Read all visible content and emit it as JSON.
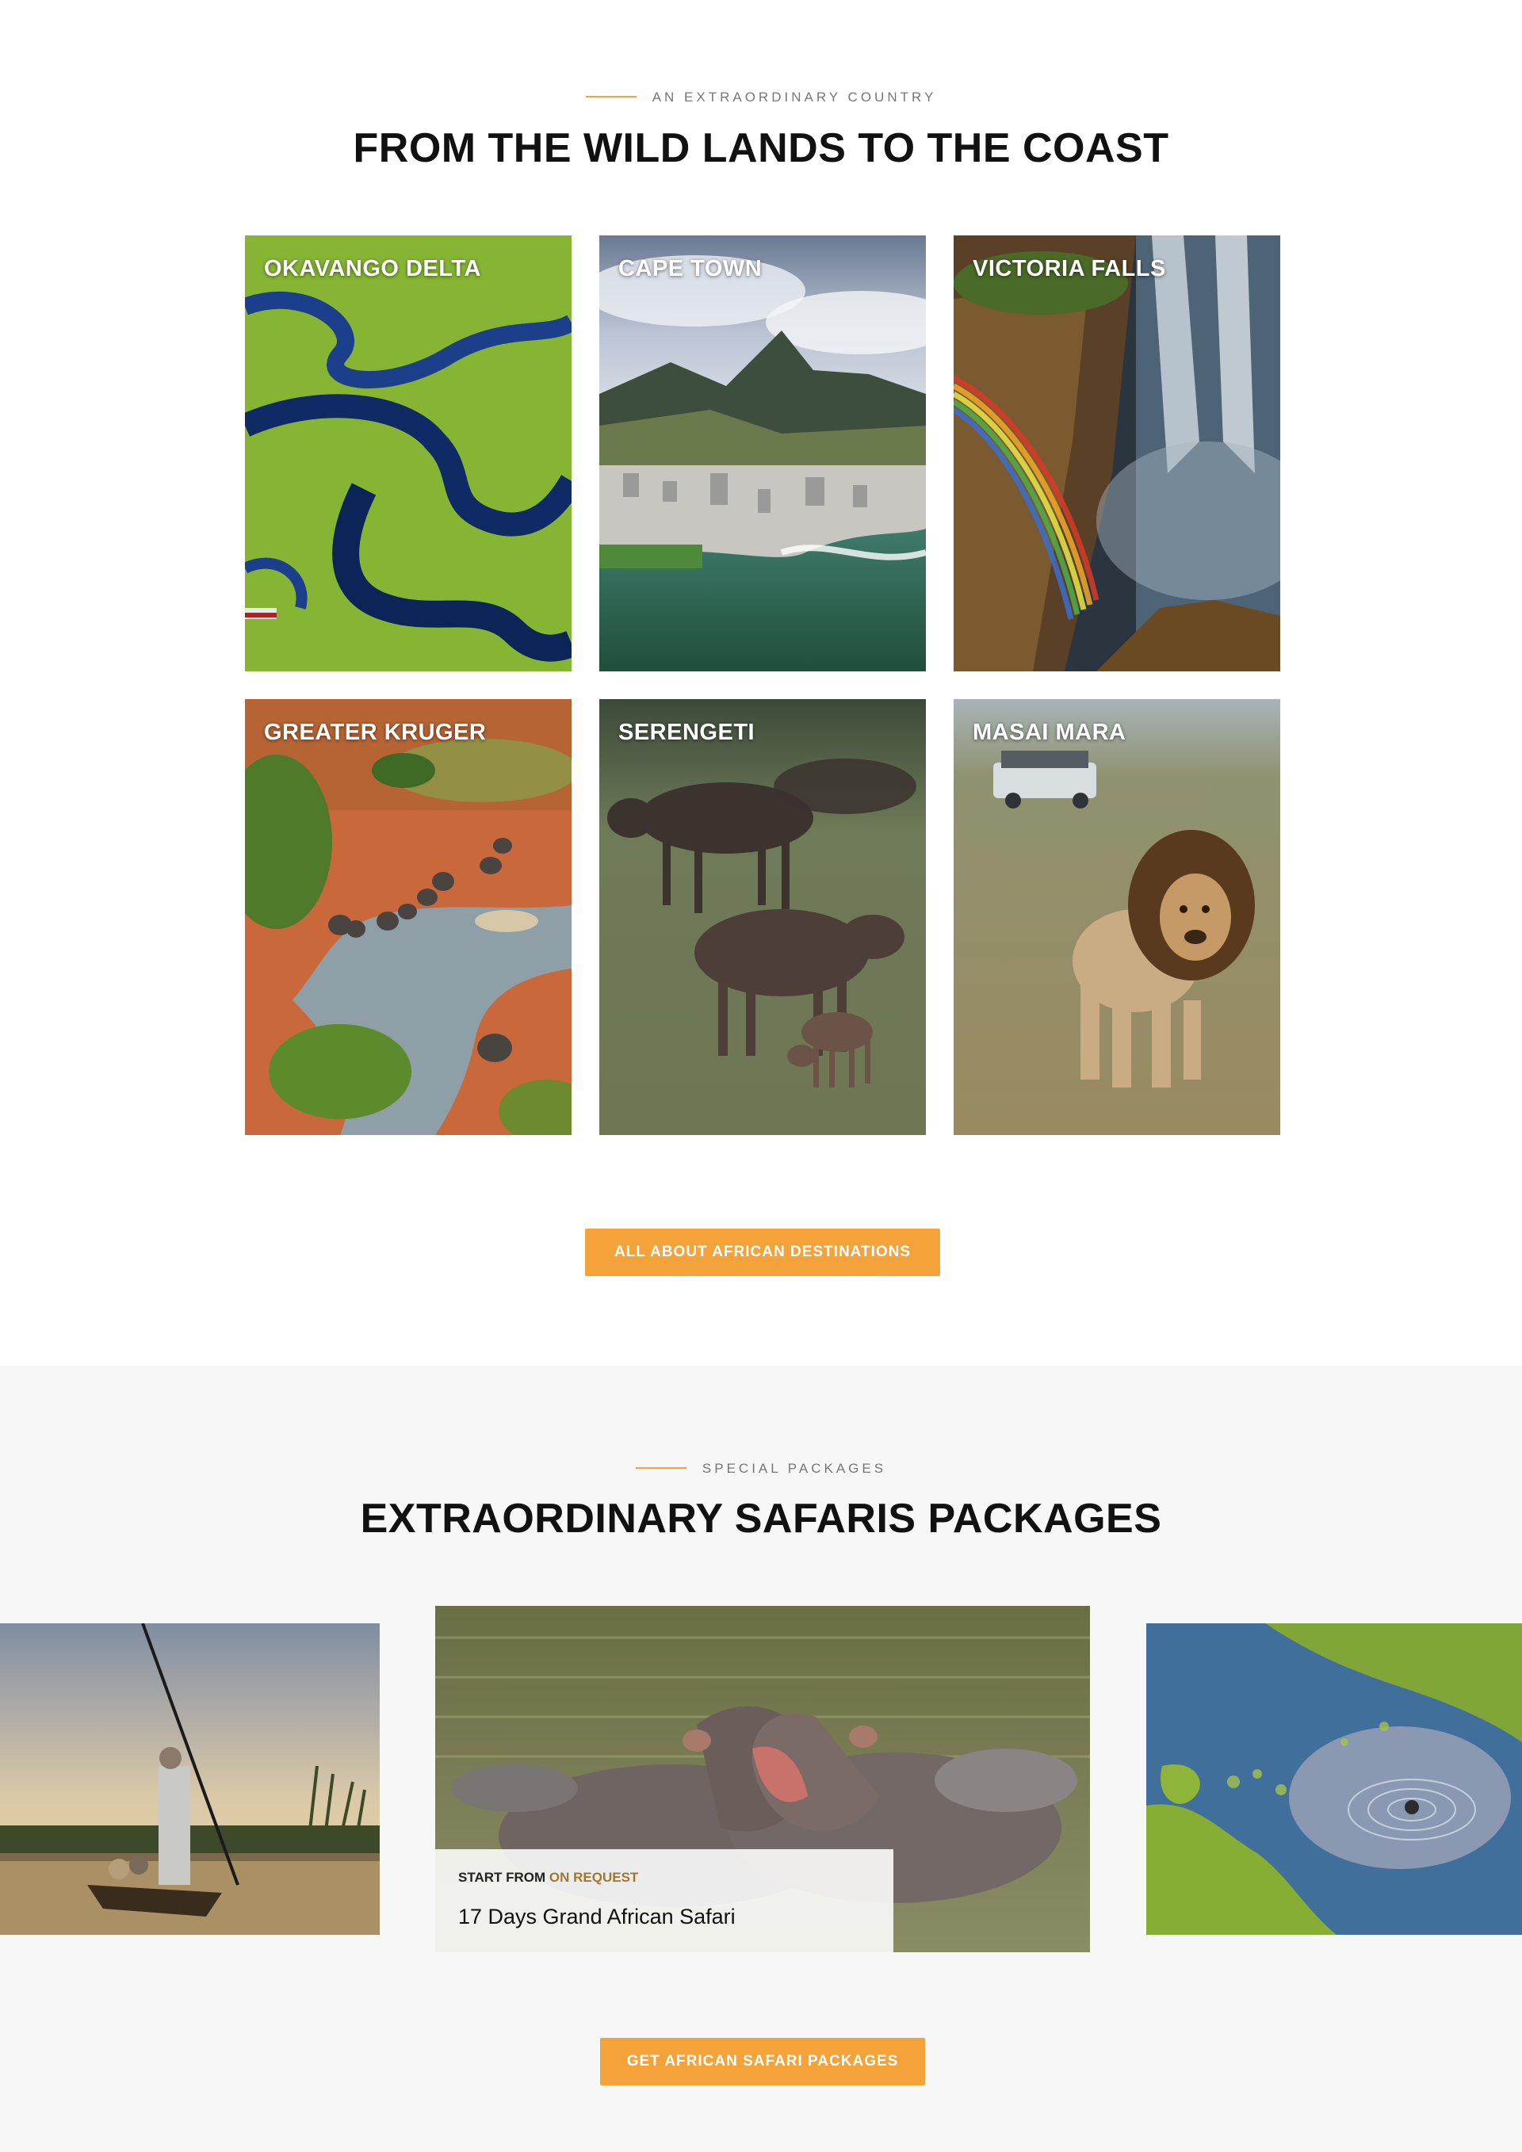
{
  "destinations": {
    "eyebrow": "AN EXTRAORDINARY COUNTRY",
    "heading": "FROM THE WILD LANDS TO THE COAST",
    "tiles": [
      {
        "label": "OKAVANGO DELTA"
      },
      {
        "label": "CAPE TOWN"
      },
      {
        "label": "VICTORIA FALLS"
      },
      {
        "label": "GREATER KRUGER"
      },
      {
        "label": "SERENGETI"
      },
      {
        "label": "MASAI MARA"
      }
    ],
    "button_label": "ALL ABOUT AFRICAN DESTINATIONS"
  },
  "packages": {
    "eyebrow": "SPECIAL PACKAGES",
    "heading": "EXTRAORDINARY SAFARIS PACKAGES",
    "active": {
      "price_prefix": "START FROM",
      "price_value": "ON REQUEST",
      "title": "17 Days Grand African Safari"
    },
    "button_label": "GET AFRICAN SAFARI PACKAGES"
  },
  "colors": {
    "accent": "#f4a23a",
    "rule": "#f2a53c",
    "price_accent": "#a3762f",
    "section_bg": "#f7f7f7"
  }
}
